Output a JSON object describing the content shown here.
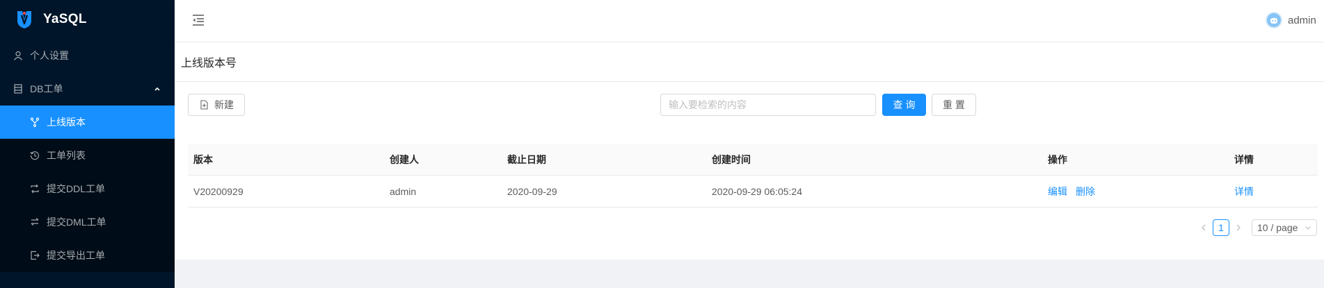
{
  "app": {
    "name": "YaSQL"
  },
  "sidebar": {
    "items": [
      {
        "label": "个人设置",
        "icon": "user-icon"
      },
      {
        "label": "DB工单",
        "icon": "database-icon",
        "expanded": true
      }
    ],
    "subitems": [
      {
        "label": "上线版本",
        "icon": "branch-icon",
        "active": true
      },
      {
        "label": "工单列表",
        "icon": "history-icon"
      },
      {
        "label": "提交DDL工单",
        "icon": "swap-icon"
      },
      {
        "label": "提交DML工单",
        "icon": "exchange-icon"
      },
      {
        "label": "提交导出工单",
        "icon": "export-icon"
      }
    ]
  },
  "header": {
    "user": "admin"
  },
  "page": {
    "title": "上线版本号",
    "new_label": "新建",
    "search_placeholder": "输入要检索的内容",
    "query_label": "查 询",
    "reset_label": "重 置"
  },
  "table": {
    "columns": [
      "版本",
      "创建人",
      "截止日期",
      "创建时间",
      "操作",
      "详情"
    ],
    "rows": [
      {
        "version": "V20200929",
        "creator": "admin",
        "deadline": "2020-09-29",
        "created": "2020-09-29 06:05:24",
        "edit": "编辑",
        "delete": "删除",
        "detail": "详情"
      }
    ]
  },
  "pagination": {
    "current": "1",
    "page_size": "10 / page"
  },
  "colors": {
    "primary": "#1890ff",
    "sidebar": "#001529",
    "submenu": "#000c17"
  }
}
